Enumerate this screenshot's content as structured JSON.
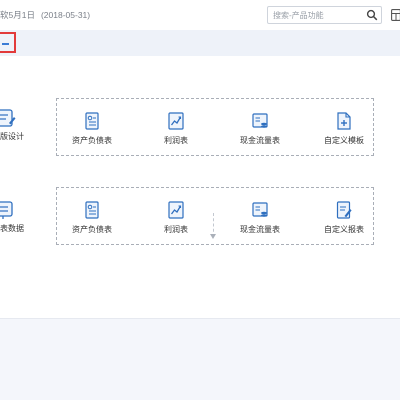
{
  "header": {
    "title_fragment": "软5月1日",
    "date_fragment": "(2018-05-31)",
    "search": {
      "placeholder": "搜索-产品功能",
      "value": ""
    }
  },
  "left_items": [
    {
      "label": "版设计",
      "icon": "report-design-icon"
    },
    {
      "label": "表数据",
      "icon": "report-data-icon"
    }
  ],
  "template_group": {
    "items": [
      {
        "label": "资产负债表",
        "icon": "balance-sheet-icon"
      },
      {
        "label": "利润表",
        "icon": "profit-chart-icon"
      },
      {
        "label": "现金流量表",
        "icon": "cash-flow-icon"
      },
      {
        "label": "自定义模板",
        "icon": "custom-template-icon"
      }
    ]
  },
  "report_group": {
    "items": [
      {
        "label": "资产负债表",
        "icon": "balance-sheet-icon"
      },
      {
        "label": "利润表",
        "icon": "profit-chart-icon"
      },
      {
        "label": "现金流量表",
        "icon": "cash-flow-icon"
      },
      {
        "label": "自定义报表",
        "icon": "custom-report-icon"
      }
    ]
  },
  "colors": {
    "accent": "#3a7bd5",
    "highlight_border": "#e23a3a",
    "page_background": "#f4f6fb"
  }
}
